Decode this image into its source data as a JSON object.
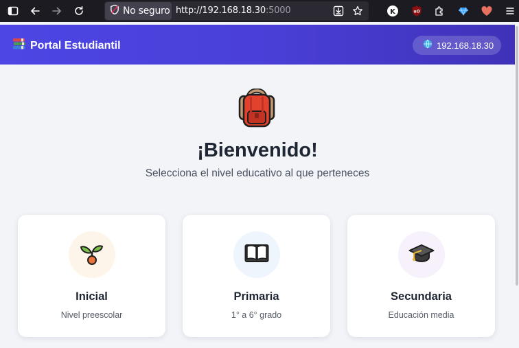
{
  "browser": {
    "security_label": "No seguro",
    "url_host": "http://192.168.18.30",
    "url_port": ":5000"
  },
  "header": {
    "title": "Portal Estudiantil",
    "ip_badge": "192.168.18.30"
  },
  "main": {
    "welcome": "¡Bienvenido!",
    "subtitle": "Selecciona el nivel educativo al que perteneces",
    "levels": [
      {
        "name": "Inicial",
        "description": "Nivel preescolar",
        "icon": "seedling-icon",
        "bg": "#fdf5e9"
      },
      {
        "name": "Primaria",
        "description": "1° a 6° grado",
        "icon": "open-book-icon",
        "bg": "#eef5fd"
      },
      {
        "name": "Secundaria",
        "description": "Educación media",
        "icon": "graduation-cap-icon",
        "bg": "#f7f1fc"
      }
    ]
  },
  "colors": {
    "header_start": "#4d46e4",
    "header_end": "#3f32b8",
    "page_bg": "#f2f4f8",
    "text_dark": "#1e2533"
  }
}
